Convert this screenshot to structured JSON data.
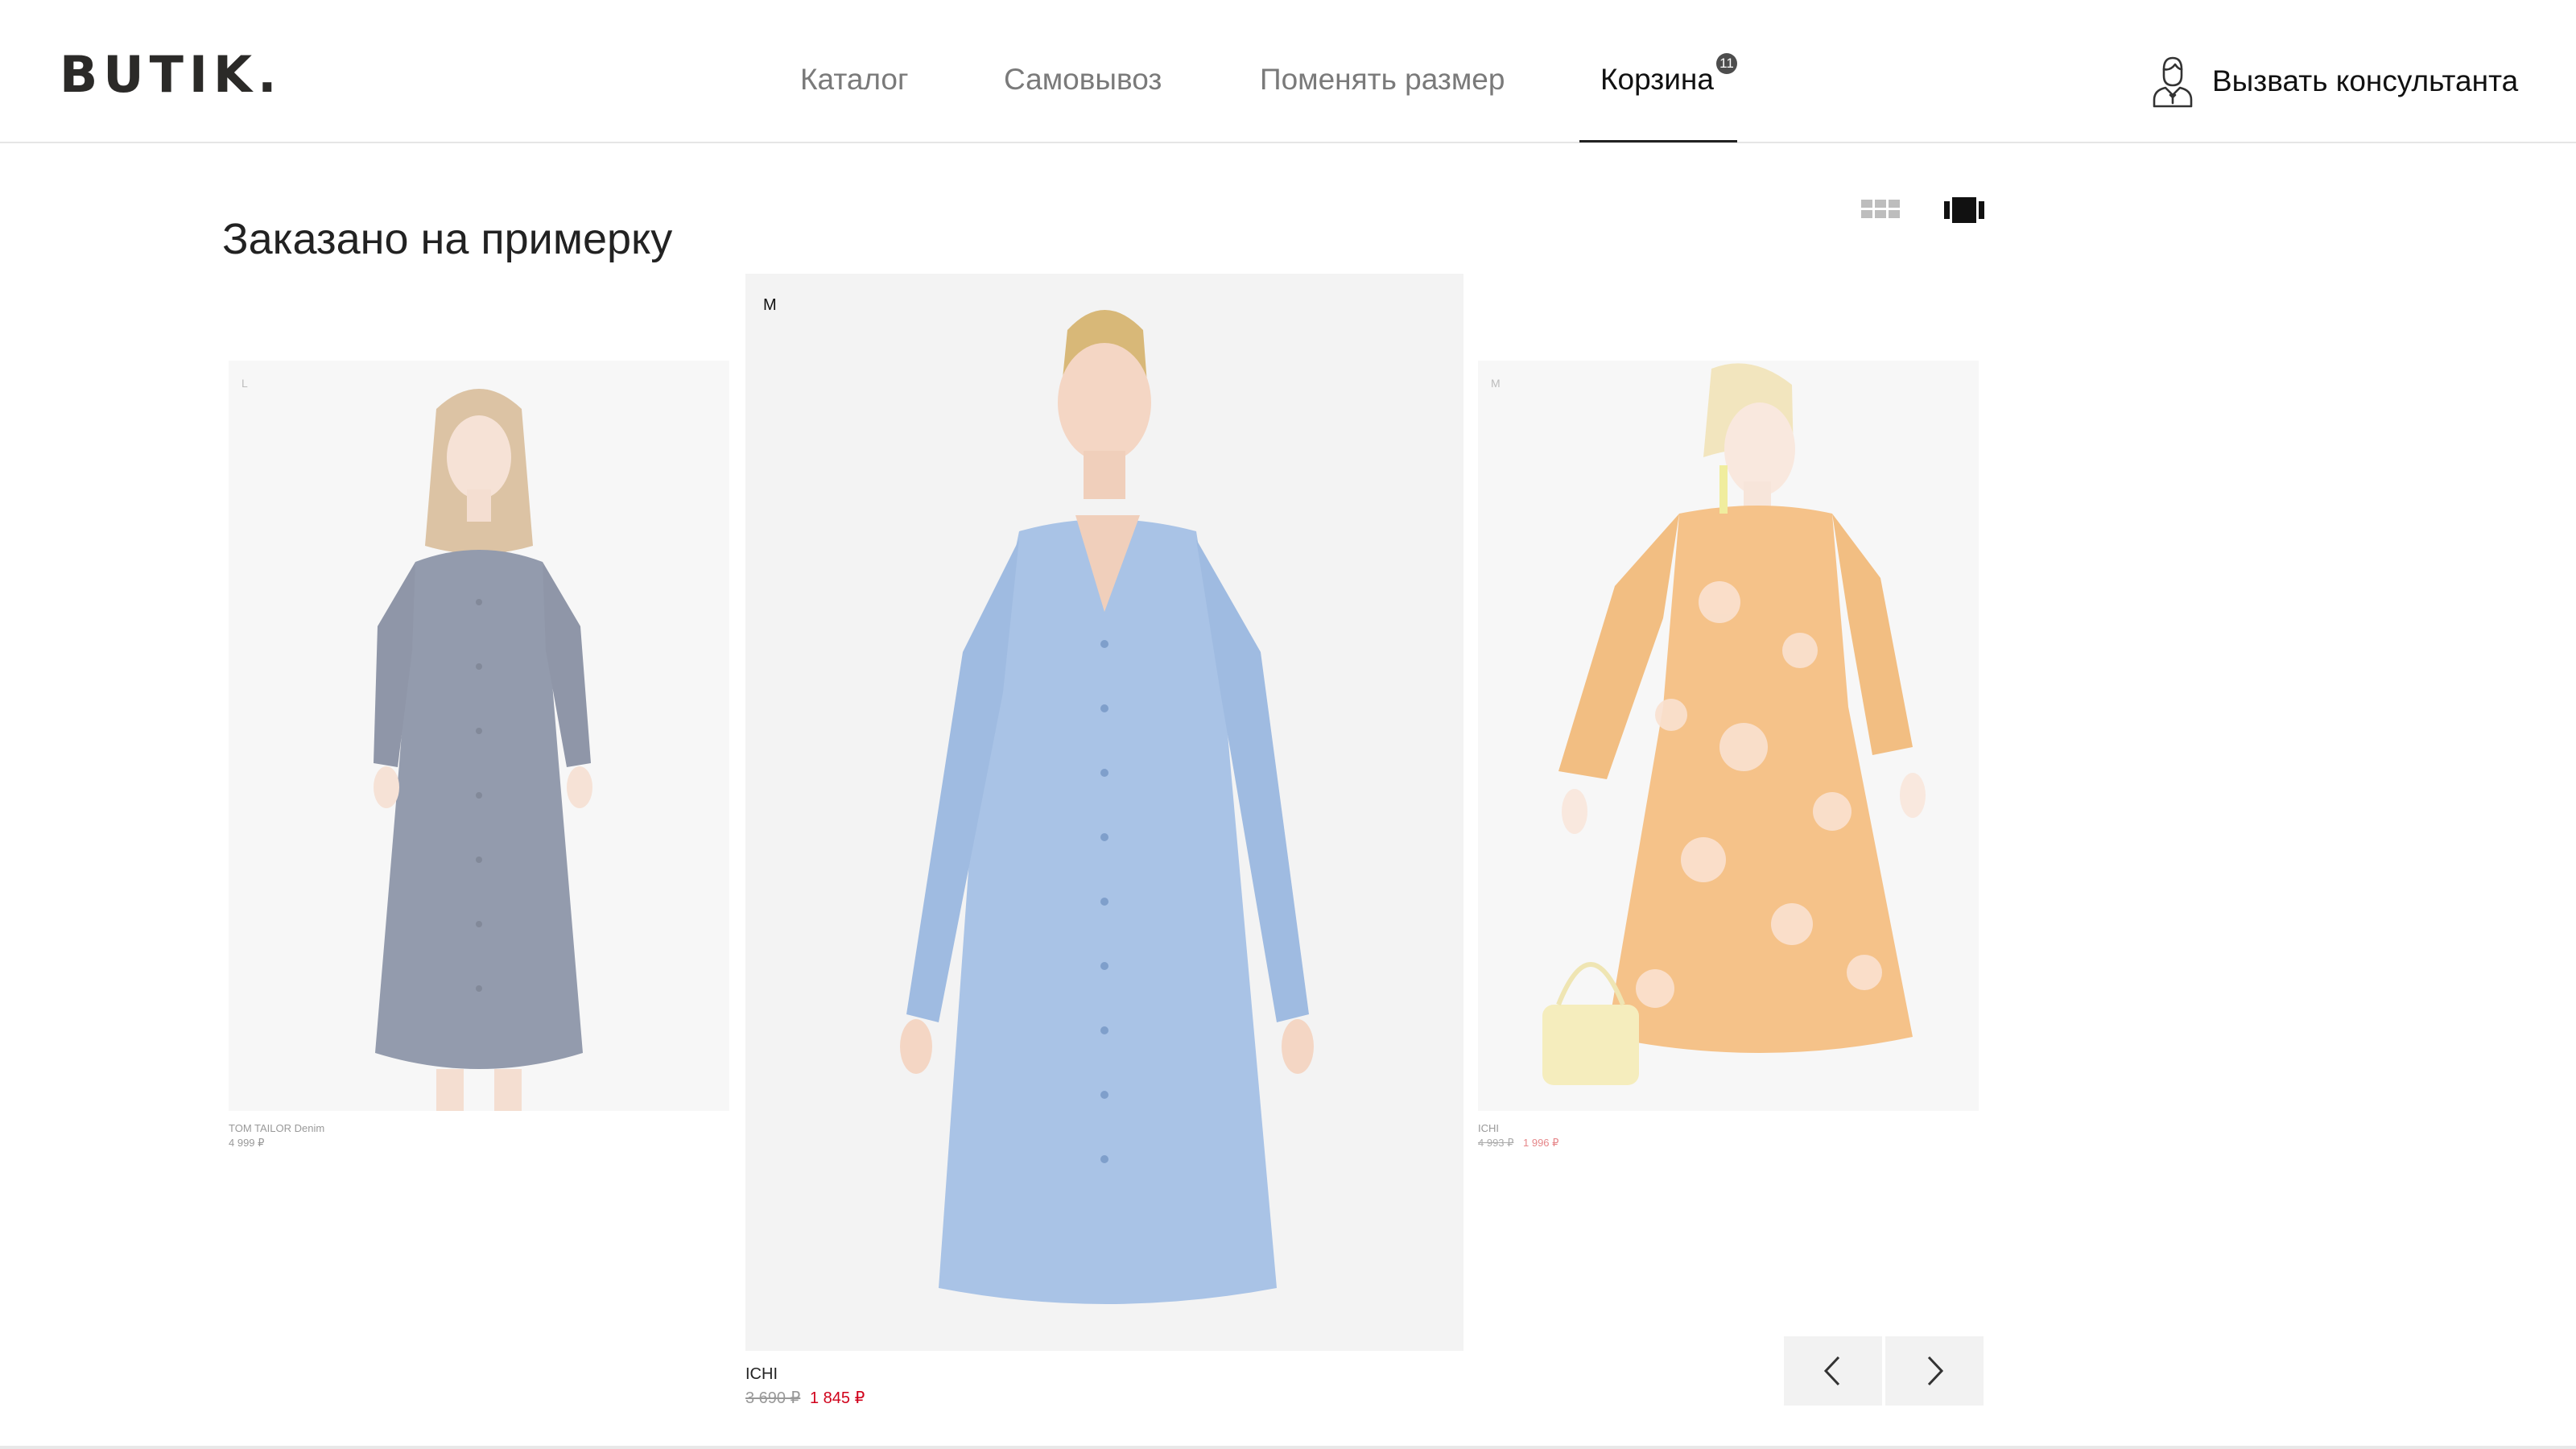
{
  "header": {
    "logo": "BUTIK.",
    "nav": [
      {
        "label": "Каталог"
      },
      {
        "label": "Самовывоз"
      },
      {
        "label": "Поменять размер"
      },
      {
        "label": "Корзина",
        "badge": "11",
        "active": true
      }
    ],
    "consultant": {
      "label": "Вызвать консультанта",
      "icon": "consultant-icon"
    }
  },
  "main": {
    "title": "Заказано на примерку",
    "view_modes": [
      {
        "icon": "grid-view-icon",
        "active": false
      },
      {
        "icon": "carousel-view-icon",
        "active": true
      }
    ],
    "products": [
      {
        "size": "L",
        "brand": "TOM TAILOR Denim",
        "price": "4 999 ₽",
        "color": "#5a6681"
      },
      {
        "size": "M",
        "brand": "ICHI",
        "price_old": "3 690 ₽",
        "price_new": "1 845 ₽",
        "color": "#a9c3e6"
      },
      {
        "size": "M",
        "brand": "ICHI",
        "price_old": "4 993 ₽",
        "price_new": "1 996 ₽",
        "color": "#f0a24a"
      }
    ],
    "pager": {
      "prev_icon": "chevron-left-icon",
      "next_icon": "chevron-right-icon"
    }
  },
  "colors": {
    "accent_price": "#d0021b",
    "text": "#222222",
    "muted": "#7a7a7a"
  }
}
